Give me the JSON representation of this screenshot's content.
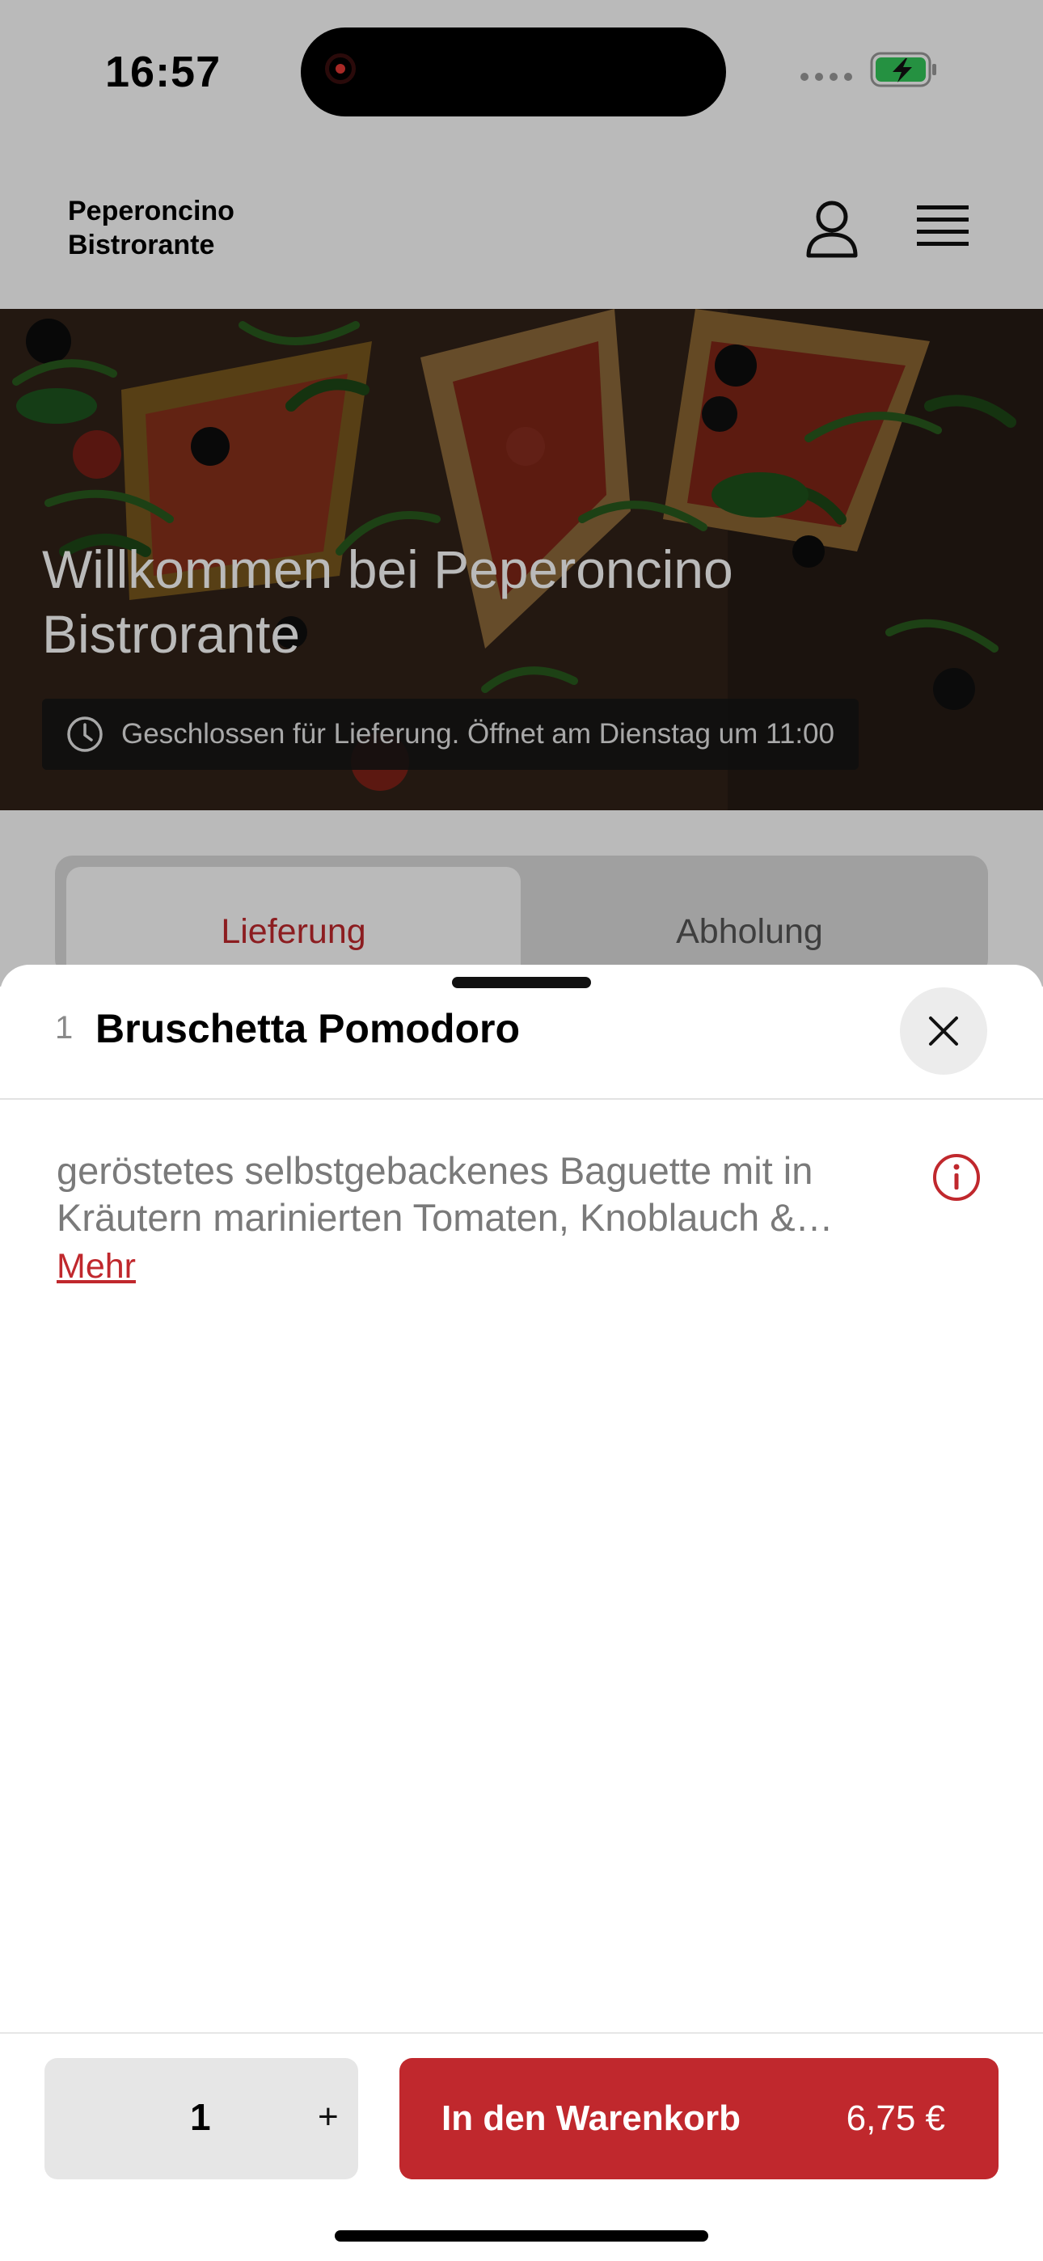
{
  "status_bar": {
    "time": "16:57",
    "signal_icon": "signal-dots-icon",
    "battery_icon": "battery-charging-icon",
    "battery_color": "#34c759"
  },
  "header": {
    "brand": "Peperoncino\nBistrorante",
    "account_icon": "user-icon",
    "menu_icon": "hamburger-menu-icon"
  },
  "hero": {
    "title": "Willkommen bei Peperoncino Bistrorante",
    "status_icon": "clock-icon",
    "status_text": "Geschlossen für Lieferung. Öffnet am Dienstag um 11:00"
  },
  "tabs": [
    {
      "label": "Lieferung",
      "active": true
    },
    {
      "label": "Abholung",
      "active": false
    }
  ],
  "sheet": {
    "item_number": "1",
    "item_title": "Bruschetta Pomodoro",
    "close_icon": "close-icon",
    "description": "geröstetes selbstgebackenes Baguette mit in Kräutern marinierten Tomaten, Knoblauch & Basilikum",
    "more_label": "Mehr",
    "info_icon": "info-icon"
  },
  "footer": {
    "quantity": "1",
    "plus_label": "+",
    "add_to_cart_label": "In den Warenkorb",
    "price": "6,75 €"
  },
  "colors": {
    "accent": "#c0282d",
    "tab_track": "#dcdcdc",
    "muted_text": "#7a7a7a"
  }
}
